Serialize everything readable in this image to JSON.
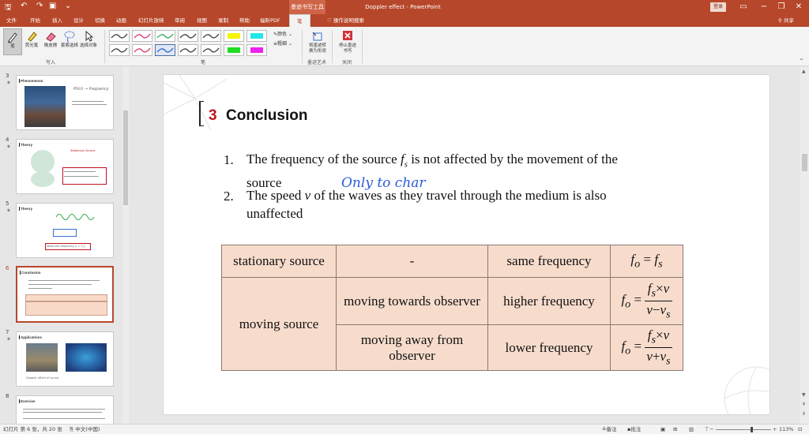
{
  "window": {
    "context_tab_title": "墨迹书写工具",
    "doc_title": "Doppler effect  -  PowerPoint",
    "signin_label": "登录",
    "quick_access": [
      "save-icon",
      "undo-icon",
      "redo-icon",
      "start-from-beginning-icon"
    ],
    "controls": {
      "ribbon_options": "▭",
      "minimize": "−",
      "restore": "❐",
      "close": "✕"
    }
  },
  "tabs": [
    "文件",
    "开始",
    "插入",
    "设计",
    "切换",
    "动画",
    "幻灯片放映",
    "审阅",
    "视图",
    "录制",
    "帮助",
    "福昕PDF",
    "笔"
  ],
  "active_tab": "笔",
  "tell_me": "操作说明搜索",
  "share": "共享",
  "ribbon": {
    "write_group": {
      "label": "写入",
      "buttons": [
        "笔",
        "荧光笔",
        "橡皮擦",
        "套索选择",
        "选择对象"
      ]
    },
    "pens_group": {
      "label": "笔",
      "pens": [
        {
          "color": "#3b3b3b"
        },
        {
          "color": "#d6336c"
        },
        {
          "color": "#2fa84f"
        },
        {
          "color": "#3b3b3b"
        },
        {
          "color": "#3b3b3b"
        },
        {
          "color": "#f5f500"
        },
        {
          "color": "#20e8e8"
        },
        {
          "color": "#3b3b3b"
        },
        {
          "color": "#d6336c"
        },
        {
          "color": "#2f5fd7"
        },
        {
          "color": "#3b3b3b"
        },
        {
          "color": "#3b3b3b"
        },
        {
          "color": "#22dd22"
        },
        {
          "color": "#ee22ee"
        }
      ],
      "color_label": "颜色",
      "thickness_label": "粗细"
    },
    "convert_group": {
      "label": "墨迹艺术",
      "button": "将墨迹转换为形状"
    },
    "close_group": {
      "label": "关闭",
      "button": "停止墨迹书写"
    }
  },
  "thumbnails": [
    {
      "number": "3",
      "title": "Phenomenon",
      "caption": "Pitch → frequency"
    },
    {
      "number": "4",
      "title": "Theory",
      "caption": "Stationary Source"
    },
    {
      "number": "5",
      "title": "Theory",
      "caption": "observed frequency f₀ = f_s"
    },
    {
      "number": "6",
      "title": "Conclusion",
      "caption": "",
      "active": true
    },
    {
      "number": "7",
      "title": "Applications",
      "caption": "Doppler effect of sound"
    },
    {
      "number": "8",
      "title": "Exercise",
      "caption": ""
    }
  ],
  "slide": {
    "number": "3",
    "title": "Conclusion",
    "points": [
      {
        "num": "1.",
        "line1": "The frequency of the source ",
        "sym": "f",
        "sub": "s",
        "line1b": " is not affected by the movement of the",
        "line2": "source"
      },
      {
        "num": "2.",
        "line1": "The speed ",
        "sym": "v",
        "line1b": " of the waves as they travel through the medium is also",
        "line2": "unaffected"
      }
    ],
    "ink_annotation": "Only to char",
    "table": {
      "row1": {
        "col1": "stationary source",
        "col2": "-",
        "col3": "same frequency",
        "formula": "f_o = f_s"
      },
      "moving_label": "moving source",
      "row2": {
        "col2": "moving towards observer",
        "col3": "higher frequency",
        "formula": "f_o = f_s×v / (v−v_s)"
      },
      "row3": {
        "col2": "moving away from observer",
        "col3": "lower frequency",
        "formula": "f_o = f_s×v / (v+v_s)"
      }
    }
  },
  "status": {
    "slide_info": "幻灯片 第 6 张，共 20 张",
    "language": "中文(中国)",
    "notes": "备注",
    "comments": "批注",
    "zoom": "113%"
  }
}
